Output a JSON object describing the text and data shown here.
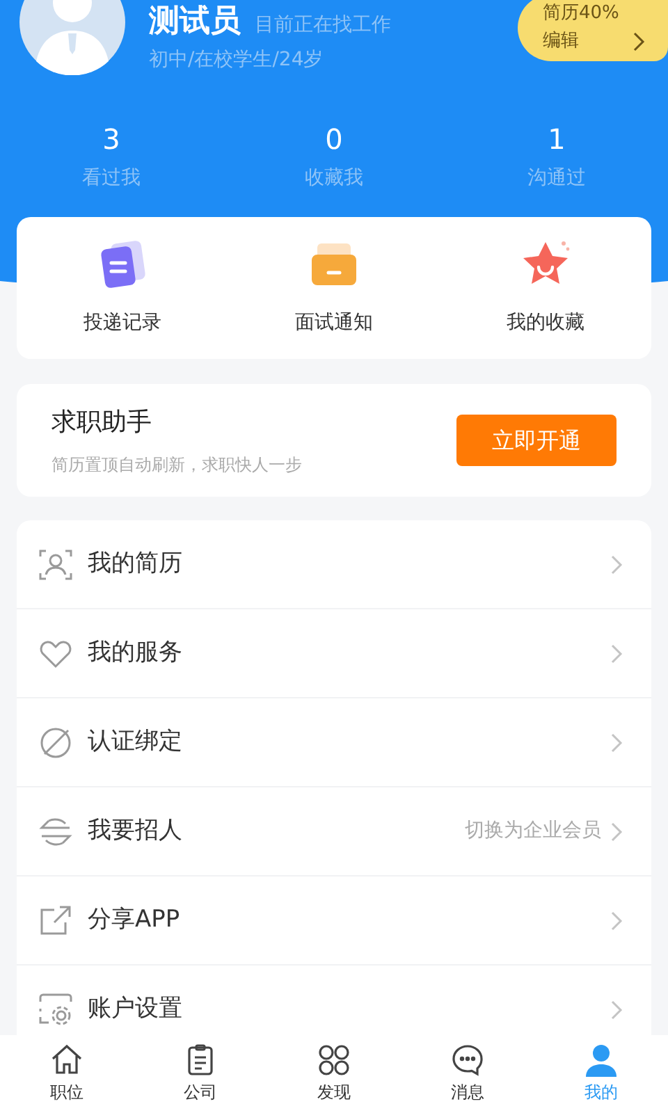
{
  "profile": {
    "name": "测试员",
    "status": "目前正在找工作",
    "details": "初中/在校学生/24岁",
    "resume_badge": {
      "progress": "简历40%",
      "action": "编辑"
    }
  },
  "stats": [
    {
      "value": "3",
      "label": "看过我"
    },
    {
      "value": "0",
      "label": "收藏我"
    },
    {
      "value": "1",
      "label": "沟通过"
    }
  ],
  "shortcuts": [
    {
      "label": "投递记录"
    },
    {
      "label": "面试通知"
    },
    {
      "label": "我的收藏"
    }
  ],
  "assistant": {
    "title": "求职助手",
    "subtitle": "简历置顶自动刷新，求职快人一步",
    "button": "立即开通"
  },
  "menu": [
    {
      "label": "我的简历"
    },
    {
      "label": "我的服务"
    },
    {
      "label": "认证绑定"
    },
    {
      "label": "我要招人",
      "hint": "切换为企业会员"
    },
    {
      "label": "分享APP"
    },
    {
      "label": "账户设置"
    }
  ],
  "tab_bar": [
    {
      "label": "职位",
      "selected": false
    },
    {
      "label": "公司",
      "selected": false
    },
    {
      "label": "发现",
      "selected": false
    },
    {
      "label": "消息",
      "selected": false
    },
    {
      "label": "我的",
      "selected": true
    }
  ]
}
